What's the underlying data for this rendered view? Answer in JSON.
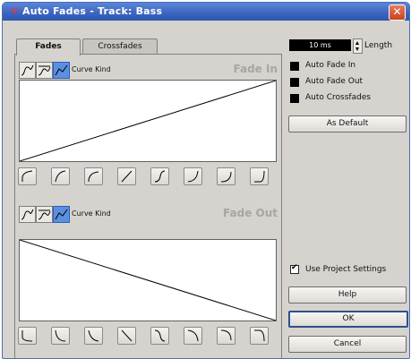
{
  "window": {
    "title": "Auto Fades - Track: Bass",
    "close_glyph": "✕"
  },
  "tabs": [
    {
      "label": "Fades",
      "active": true
    },
    {
      "label": "Crossfades",
      "active": false
    }
  ],
  "fade_in": {
    "section_label": "Fade In",
    "curve_kind_label": "Curve Kind",
    "curve_kinds": [
      "spline-icon",
      "damped-spline-icon",
      "linear-curve-icon"
    ],
    "selected_kind": "linear-curve-icon",
    "presets": [
      "fade-in-preset-1",
      "fade-in-preset-2",
      "fade-in-preset-3",
      "fade-in-preset-4",
      "fade-in-preset-5",
      "fade-in-preset-6",
      "fade-in-preset-7",
      "fade-in-preset-8"
    ]
  },
  "fade_out": {
    "section_label": "Fade Out",
    "curve_kind_label": "Curve Kind",
    "curve_kinds": [
      "spline-icon",
      "damped-spline-icon",
      "linear-curve-icon"
    ],
    "selected_kind": "linear-curve-icon",
    "presets": [
      "fade-out-preset-1",
      "fade-out-preset-2",
      "fade-out-preset-3",
      "fade-out-preset-4",
      "fade-out-preset-5",
      "fade-out-preset-6",
      "fade-out-preset-7",
      "fade-out-preset-8"
    ]
  },
  "settings": {
    "length_value": "10 ms",
    "length_label": "Length",
    "auto_fade_in": {
      "label": "Auto Fade In",
      "checked": false
    },
    "auto_fade_out": {
      "label": "Auto Fade Out",
      "checked": false
    },
    "auto_crossfades": {
      "label": "Auto Crossfades",
      "checked": false
    },
    "as_default_label": "As Default",
    "use_project_settings": {
      "label": "Use Project Settings",
      "checked": true
    }
  },
  "buttons": {
    "help": "Help",
    "ok": "OK",
    "cancel": "Cancel"
  },
  "colors": {
    "titlebar": "#3a64bf",
    "selected_button": "#5b8fe0",
    "dialog_bg": "#d6d3ce"
  }
}
